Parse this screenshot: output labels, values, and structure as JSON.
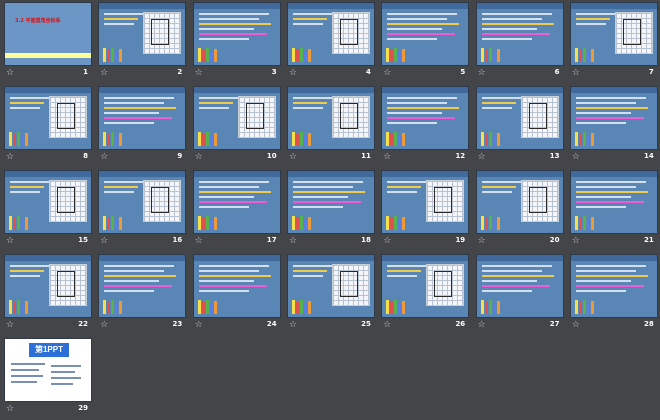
{
  "view": "slide-sorter",
  "title_slide": {
    "heading": "3.2 平面直角坐标系"
  },
  "ppt_logo": "第1PPT",
  "icon_name": "slide-transition-star-icon",
  "slides": [
    {
      "number": "1",
      "kind": "title"
    },
    {
      "number": "2",
      "kind": "grid"
    },
    {
      "number": "3",
      "kind": "text"
    },
    {
      "number": "4",
      "kind": "grid"
    },
    {
      "number": "5",
      "kind": "text"
    },
    {
      "number": "6",
      "kind": "text"
    },
    {
      "number": "7",
      "kind": "grid"
    },
    {
      "number": "8",
      "kind": "grid"
    },
    {
      "number": "9",
      "kind": "text"
    },
    {
      "number": "10",
      "kind": "grid"
    },
    {
      "number": "11",
      "kind": "grid"
    },
    {
      "number": "12",
      "kind": "text"
    },
    {
      "number": "13",
      "kind": "grid"
    },
    {
      "number": "14",
      "kind": "text"
    },
    {
      "number": "15",
      "kind": "grid"
    },
    {
      "number": "16",
      "kind": "grid"
    },
    {
      "number": "17",
      "kind": "text"
    },
    {
      "number": "18",
      "kind": "text"
    },
    {
      "number": "19",
      "kind": "grid"
    },
    {
      "number": "20",
      "kind": "grid"
    },
    {
      "number": "21",
      "kind": "text"
    },
    {
      "number": "22",
      "kind": "grid"
    },
    {
      "number": "23",
      "kind": "text"
    },
    {
      "number": "24",
      "kind": "text"
    },
    {
      "number": "25",
      "kind": "grid"
    },
    {
      "number": "26",
      "kind": "grid"
    },
    {
      "number": "27",
      "kind": "text"
    },
    {
      "number": "28",
      "kind": "text"
    },
    {
      "number": "29",
      "kind": "ppt"
    }
  ]
}
